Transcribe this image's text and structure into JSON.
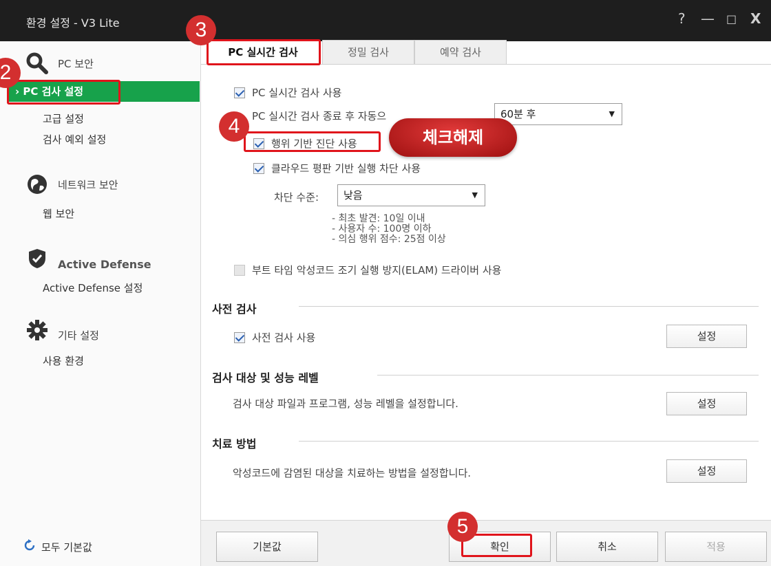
{
  "window": {
    "title": "환경 설정 - V3 Lite",
    "controls": {
      "help": "?",
      "minimize": "—",
      "maximize": "□",
      "close": "X"
    }
  },
  "sidebar": {
    "groups": [
      {
        "icon": "search-icon",
        "label": "PC 보안",
        "items": [
          "› PC 검사 설정",
          "고급 설정",
          "검사 예외 설정"
        ]
      },
      {
        "icon": "globe-icon",
        "label": "네트워크 보안",
        "items": [
          "웹 보안"
        ]
      },
      {
        "icon": "shield-check-icon",
        "label": "Active Defense",
        "items": [
          "Active Defense 설정"
        ]
      },
      {
        "icon": "gear-icon",
        "label": "기타 설정",
        "items": [
          "사용 환경"
        ]
      }
    ],
    "reset_label": "모두 기본값"
  },
  "tabs": [
    "PC 실시간 검사",
    "정밀 검사",
    "예약 검사"
  ],
  "realtime": {
    "use_label": "PC 실시간 검사 사용",
    "autorestart_label": "PC 실시간 검사 종료 후 자동으",
    "autorestart_value": "60분 후",
    "behavior_label": "행위 기반 진단 사용",
    "cloud_label": "클라우드 평판 기반 실행 차단 사용",
    "block_level_label": "차단 수준:",
    "block_level_value": "낮음",
    "block_notes": [
      "- 최초 발견: 10일 이내",
      "- 사용자 수: 100명 이하",
      "- 의심 행위 점수: 25점 이상"
    ],
    "elam_label": "부트 타임 악성코드 조기 실행 방지(ELAM) 드라이버 사용"
  },
  "sections": {
    "precheck": {
      "title": "사전 검사",
      "checkbox_label": "사전 검사 사용",
      "button": "설정"
    },
    "target": {
      "title": "검사 대상 및 성능 레벨",
      "desc": "검사 대상 파일과 프로그램, 성능 레벨을 설정합니다.",
      "button": "설정"
    },
    "treatment": {
      "title": "치료 방법",
      "desc": "악성코드에 감염된 대상을 치료하는 방법을 설정합니다.",
      "button": "설정"
    }
  },
  "bottom": {
    "default": "기본값",
    "ok": "확인",
    "cancel": "취소",
    "apply": "적용"
  },
  "annotations": {
    "steps": [
      "2",
      "3",
      "4",
      "5"
    ],
    "callout": "체크해제",
    "color": "#e0141b"
  },
  "colors": {
    "active_green": "#17a24b",
    "titlebar": "#1e1e1e"
  }
}
